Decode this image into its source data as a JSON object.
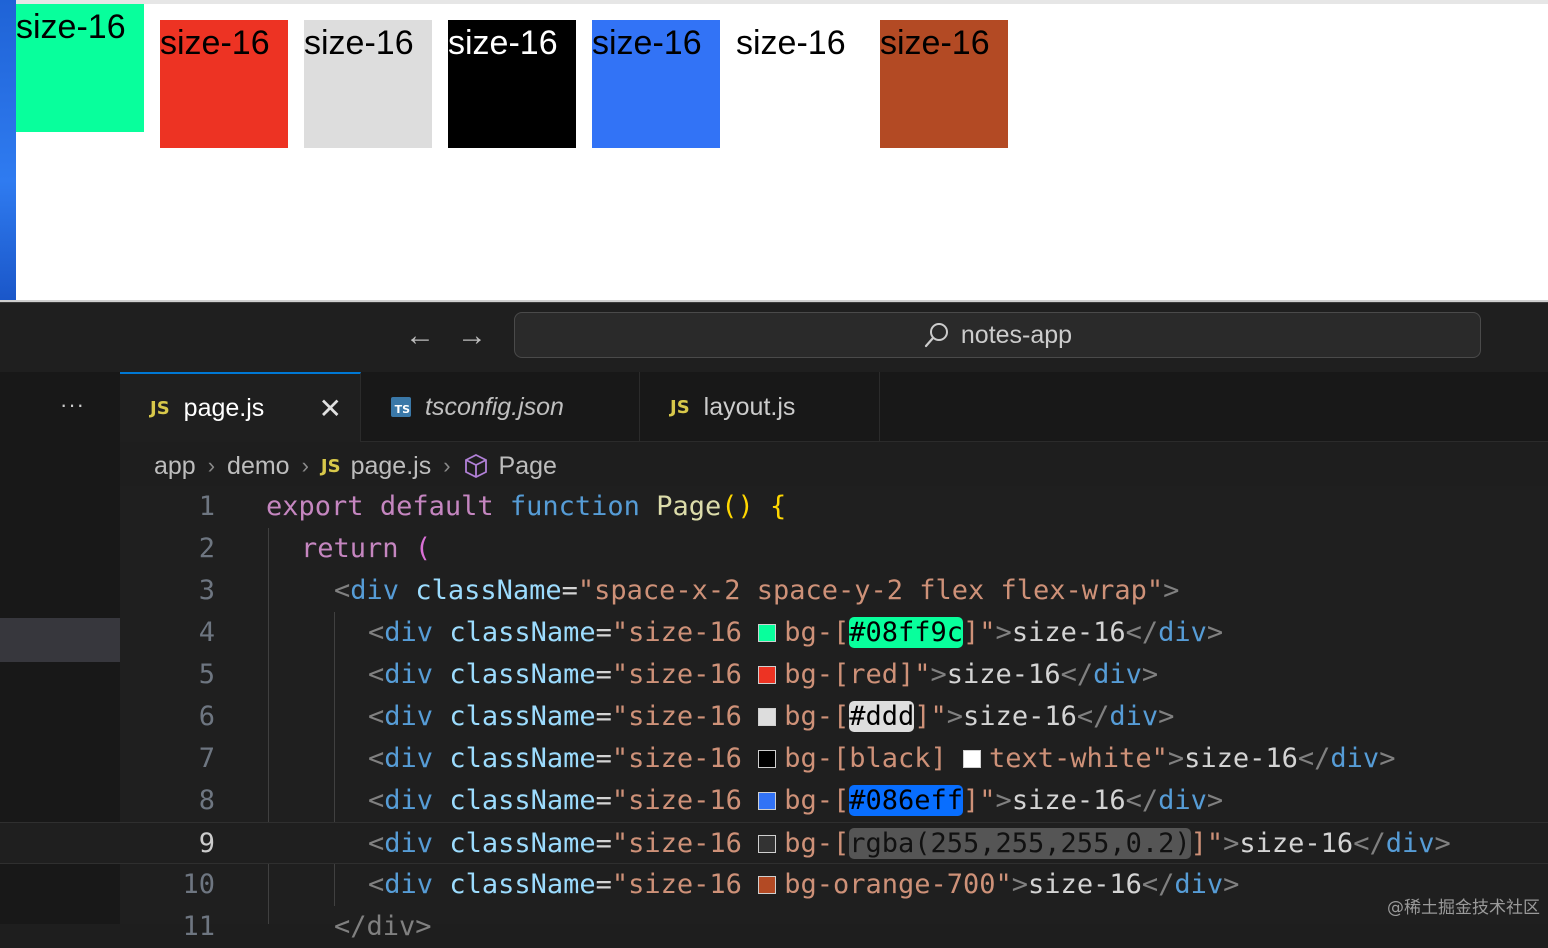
{
  "preview": {
    "swatches": [
      {
        "label": "size-16",
        "bg": "#08ff9c",
        "fg": "#000000"
      },
      {
        "label": "size-16",
        "bg": "#ed3323",
        "fg": "#000000"
      },
      {
        "label": "size-16",
        "bg": "#dddddd",
        "fg": "#000000"
      },
      {
        "label": "size-16",
        "bg": "#000000",
        "fg": "#ffffff"
      },
      {
        "label": "size-16",
        "bg": "#3273f6",
        "fg": "#000000"
      },
      {
        "label": "size-16",
        "bg": "rgba(255,255,255,0.2)",
        "fg": "#000000"
      },
      {
        "label": "size-16",
        "bg": "#b34a24",
        "fg": "#000000"
      }
    ]
  },
  "titlebar": {
    "back_icon": "arrow-left-icon",
    "forward_icon": "arrow-right-icon",
    "search_label": "notes-app"
  },
  "activity": {
    "more_label": "···"
  },
  "tabs": [
    {
      "label": "page.js",
      "icon": "js-file-icon",
      "active": true
    },
    {
      "label": "tsconfig.json",
      "icon": "ts-file-icon",
      "active": false
    },
    {
      "label": "layout.js",
      "icon": "js-file-icon",
      "active": false
    }
  ],
  "tab_icons": {
    "js": "JS",
    "ts": "TS"
  },
  "breadcrumb": [
    "app",
    "demo",
    "page.js",
    "Page"
  ],
  "editor": {
    "current_line": 9,
    "lines": [
      {
        "n": "1"
      },
      {
        "n": "2"
      },
      {
        "n": "3"
      },
      {
        "n": "4"
      },
      {
        "n": "5"
      },
      {
        "n": "6"
      },
      {
        "n": "7"
      },
      {
        "n": "8"
      },
      {
        "n": "9"
      },
      {
        "n": "10"
      },
      {
        "n": "11"
      }
    ],
    "code": {
      "l1": {
        "export": "export",
        "default": "default",
        "function": "function",
        "name": "Page",
        "paren": "()",
        "brace": "{"
      },
      "l2": {
        "return": "return",
        "paren": "("
      },
      "l3": {
        "open": "<",
        "tag": "div",
        "attr": "className",
        "eq": "=",
        "value": "\"space-x-2 space-y-2 flex flex-wrap\"",
        "close": ">"
      },
      "rows": [
        {
          "pre": "\"size-16 ",
          "color": "#08ff9c",
          "cls": "bg-[",
          "val": "#08ff9c",
          "post": "]\"",
          "hl": "#08ff9c",
          "hlText": "#000000",
          "text": "size-16"
        },
        {
          "pre": "\"size-16 ",
          "color": "#ed3323",
          "cls": "bg-[red]\"",
          "val": "",
          "post": "",
          "hl": "",
          "hlText": "",
          "text": "size-16"
        },
        {
          "pre": "\"size-16 ",
          "color": "#dddddd",
          "cls": "bg-[",
          "val": "#ddd",
          "post": "]\"",
          "hl": "#dddddd",
          "hlText": "#000000",
          "text": "size-16"
        },
        {
          "pre": "\"size-16 ",
          "color": "#000000",
          "cls": "bg-[black] ",
          "val": "",
          "post": "text-white\"",
          "hl": "",
          "hlText": "",
          "text": "size-16",
          "color2": "#ffffff"
        },
        {
          "pre": "\"size-16 ",
          "color": "#3273f6",
          "cls": "bg-[",
          "val": "#086eff",
          "post": "]\"",
          "hl": "#086eff",
          "hlText": "#000000",
          "text": "size-16"
        },
        {
          "pre": "\"size-16 ",
          "color": "#333333",
          "cls": "bg-[",
          "val": "rgba(255,255,255,0.2)",
          "post": "]\"",
          "hl": "#555555",
          "hlText": "#111111",
          "text": "size-16"
        },
        {
          "pre": "\"size-16 ",
          "color": "#b34a24",
          "cls": "bg-orange-700\"",
          "val": "",
          "post": "",
          "hl": "",
          "hlText": "",
          "text": "size-16"
        }
      ],
      "l11": "</div>"
    }
  },
  "watermark": "@稀土掘金技术社区"
}
